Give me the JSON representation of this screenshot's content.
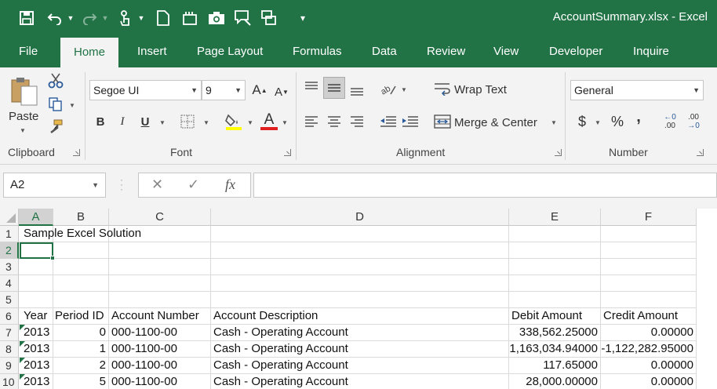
{
  "window": {
    "title": "AccountSummary.xlsx - Excel"
  },
  "qat": {
    "icons": [
      "save-icon",
      "undo-icon",
      "redo-icon",
      "touch-mode-icon",
      "new-file-icon",
      "open-icon",
      "camera-icon",
      "comment-icon",
      "tabs-icon",
      "customize-icon"
    ]
  },
  "tabs": [
    "File",
    "Home",
    "Insert",
    "Page Layout",
    "Formulas",
    "Data",
    "Review",
    "View",
    "Developer",
    "Inquire"
  ],
  "ribbon": {
    "clipboard": {
      "label": "Clipboard",
      "paste": "Paste"
    },
    "font": {
      "label": "Font",
      "name": "Segoe UI",
      "size": "9",
      "bold": "B",
      "italic": "I",
      "underline": "U",
      "grow": "A",
      "shrink": "A",
      "font_color_letter": "A"
    },
    "alignment": {
      "label": "Alignment",
      "wrap_text": "Wrap Text",
      "merge_center": "Merge & Center"
    },
    "number": {
      "label": "Number",
      "format": "General",
      "currency": "$",
      "percent": "%",
      "comma": ",",
      "inc_decimal": ".00",
      "dec_decimal": ".00"
    }
  },
  "formula_bar": {
    "name_box": "A2",
    "fx": "fx",
    "cancel": "✕",
    "enter": "✓",
    "formula": ""
  },
  "colors": {
    "accent": "#217346",
    "header_bg": "#f3f3f3"
  },
  "sheet": {
    "columns": [
      "A",
      "B",
      "C",
      "D",
      "E",
      "F"
    ],
    "rows": [
      "1",
      "2",
      "3",
      "4",
      "5",
      "6",
      "7",
      "8",
      "9",
      "10"
    ],
    "title": "Sample Excel Solution",
    "headers": [
      "Year",
      "Period ID",
      "Account Number",
      "Account Description",
      "Debit Amount",
      "Credit Amount"
    ],
    "data": [
      [
        "2013",
        "0",
        "000-1100-00",
        "Cash - Operating Account",
        "338,562.25000",
        "0.00000"
      ],
      [
        "2013",
        "1",
        "000-1100-00",
        "Cash - Operating Account",
        "1,163,034.94000",
        "-1,122,282.95000"
      ],
      [
        "2013",
        "2",
        "000-1100-00",
        "Cash - Operating Account",
        "117.65000",
        "0.00000"
      ],
      [
        "2013",
        "5",
        "000-1100-00",
        "Cash - Operating Account",
        "28,000.00000",
        "0.00000"
      ]
    ]
  }
}
